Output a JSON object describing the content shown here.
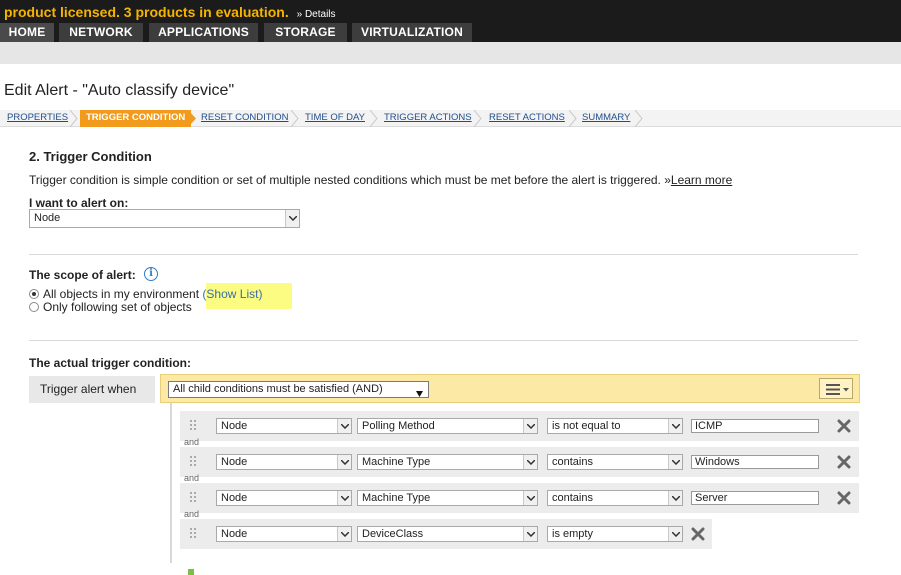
{
  "banner": {
    "license_text": "product licensed.  3 products in evaluation.",
    "details_link": "» Details"
  },
  "nav": {
    "tabs": [
      "HOME",
      "NETWORK",
      "APPLICATIONS",
      "STORAGE",
      "VIRTUALIZATION"
    ]
  },
  "page": {
    "title": "Edit Alert - \"Auto classify device\""
  },
  "wizard": {
    "steps": [
      "PROPERTIES",
      "TRIGGER CONDITION",
      "RESET CONDITION",
      "TIME OF DAY",
      "TRIGGER ACTIONS",
      "RESET ACTIONS",
      "SUMMARY"
    ],
    "active_step": "TRIGGER CONDITION"
  },
  "section": {
    "heading": "2. Trigger Condition",
    "description": "Trigger condition is simple condition or set of multiple nested conditions which must be met before the alert is triggered. »",
    "learn_more": "Learn more"
  },
  "alert_on": {
    "label": "I want to alert on:",
    "value": "Node"
  },
  "scope": {
    "label": "The scope of alert:",
    "option_all": "All objects in my environment",
    "show_list": "(Show List)",
    "option_following": "Only following set of objects",
    "selected": "all"
  },
  "trigger": {
    "section_label": "The actual trigger condition:",
    "when_label": "Trigger alert when",
    "group_mode": "All child conditions must be satisfied (AND)",
    "connector": "and",
    "conditions": [
      {
        "object": "Node",
        "field": "Polling Method",
        "operator": "is not equal to",
        "value": "ICMP"
      },
      {
        "object": "Node",
        "field": "Machine Type",
        "operator": "contains",
        "value": "Windows"
      },
      {
        "object": "Node",
        "field": "Machine Type",
        "operator": "contains",
        "value": "Server"
      },
      {
        "object": "Node",
        "field": "DeviceClass",
        "operator": "is empty",
        "value": ""
      }
    ]
  },
  "colors": {
    "license": "#f5b400",
    "active_step": "#f19a1b",
    "group_bar": "#fde9a6",
    "highlight": "#fcfc82"
  }
}
